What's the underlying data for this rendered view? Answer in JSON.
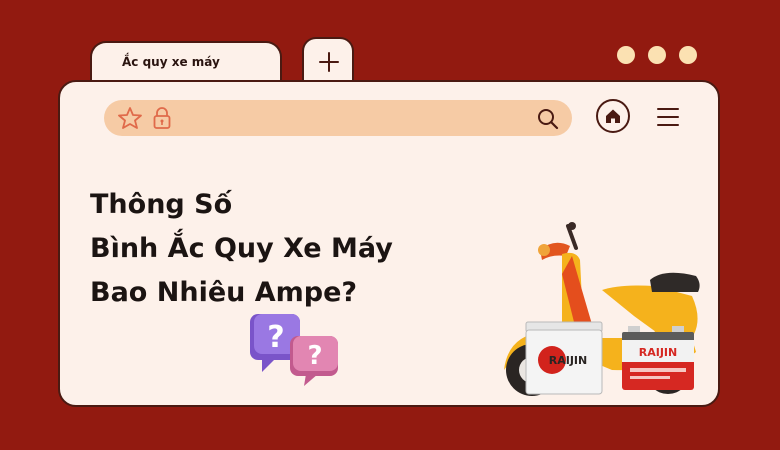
{
  "tab": {
    "title": "Ắc quy xe máy"
  },
  "toolbar": {
    "star_icon": "star-icon",
    "lock_icon": "lock-icon",
    "search_icon": "search-icon",
    "home_icon": "home-icon",
    "menu_icon": "menu-icon"
  },
  "headline": {
    "line1": "Thông Số",
    "line2": "Bình Ắc Quy Xe Máy",
    "line3": "Bao Nhiêu Ampe?"
  },
  "illustration": {
    "question_mark_1": "?",
    "question_mark_2": "?",
    "battery_brand_white": "RAIJIN",
    "battery_brand_red": "RAIJIN"
  },
  "colors": {
    "background": "#921a10",
    "window": "#fdf1ea",
    "address_bar": "#f6cba5",
    "accent": "#e06a4a",
    "window_dots": "#fbe1b2"
  }
}
